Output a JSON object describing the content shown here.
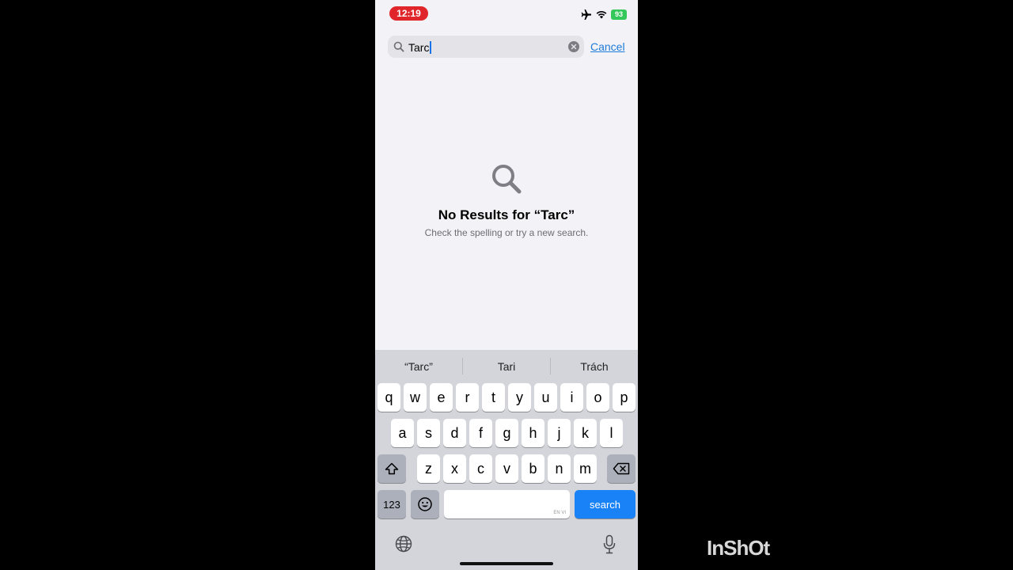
{
  "status_bar": {
    "time": "12:19",
    "battery": "93",
    "icons": [
      "airplane-icon",
      "wifi-icon",
      "battery-icon"
    ]
  },
  "search": {
    "value": "Tarc",
    "cancel_label": "Cancel"
  },
  "empty_state": {
    "title": "No Results for “Tarc”",
    "subtitle": "Check the spelling or try a new search."
  },
  "keyboard": {
    "suggestions": [
      "“Tarc”",
      "Tari",
      "Trách"
    ],
    "row1": [
      "q",
      "w",
      "e",
      "r",
      "t",
      "y",
      "u",
      "i",
      "o",
      "p"
    ],
    "row2": [
      "a",
      "s",
      "d",
      "f",
      "g",
      "h",
      "j",
      "k",
      "l"
    ],
    "row3": [
      "z",
      "x",
      "c",
      "v",
      "b",
      "n",
      "m"
    ],
    "numbers_label": "123",
    "space_lang_label": "EN VI",
    "search_label": "search"
  },
  "watermark": "InShOt",
  "colors": {
    "time_pill": "#e0262b",
    "battery": "#34c759",
    "accent": "#1e7bd6",
    "search_key": "#1a82f7"
  }
}
